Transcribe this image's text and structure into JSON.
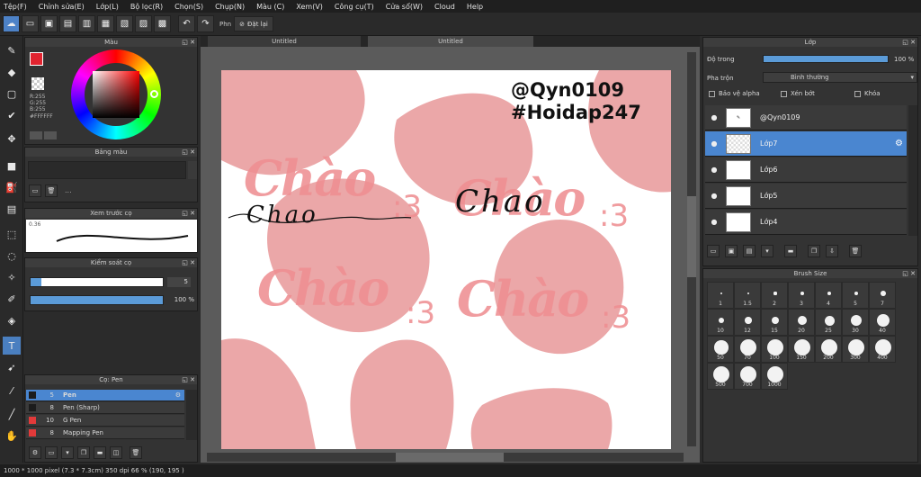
{
  "menu": [
    "Tệp(F)",
    "Chỉnh sửa(E)",
    "Lớp(L)",
    "Bộ lọc(R)",
    "Chọn(S)",
    "Chụp(N)",
    "Màu (C)",
    "Xem(V)",
    "Công cụ(T)",
    "Cửa sổ(W)",
    "Cloud",
    "Help"
  ],
  "toolbar": {
    "tool_label": "Phn",
    "reset_label": "Đặt lại"
  },
  "tabs": [
    "Untitled",
    "Untitled"
  ],
  "color_panel": {
    "title": "Màu",
    "rgb": "R:255\nG:255\nB:255",
    "hex": "#FFFFFF"
  },
  "swatch_panel": {
    "title": "Bảng màu",
    "dots": "..."
  },
  "preview_panel": {
    "title": "Xem trước cọ",
    "size": "0.36"
  },
  "brush_control": {
    "title": "Kiểm soát cọ",
    "size_value": "5",
    "opacity_value": "100 %"
  },
  "brush_panel": {
    "title": "Cọ: Pen",
    "items": [
      {
        "num": "5",
        "name": "Pen",
        "color": "#1c1c1c"
      },
      {
        "num": "8",
        "name": "Pen (Sharp)",
        "color": "#1c1c1c"
      },
      {
        "num": "10",
        "name": "G Pen",
        "color": "#e23a3a"
      },
      {
        "num": "8",
        "name": "Mapping Pen",
        "color": "#e23a3a"
      }
    ]
  },
  "layer_panel": {
    "title": "Lớp",
    "opacity_label": "Độ trong",
    "opacity_value": "100 %",
    "blend_label": "Pha trộn",
    "blend_value": "Bình thường",
    "protect_alpha": "Bảo vệ alpha",
    "clip": "Xén bớt",
    "lock": "Khóa",
    "layers": [
      {
        "name": "@Qyn0109"
      },
      {
        "name": "Lớp7"
      },
      {
        "name": "Lớp6"
      },
      {
        "name": "Lớp5"
      },
      {
        "name": "Lớp4"
      }
    ]
  },
  "brush_size_panel": {
    "title": "Brush Size",
    "sizes": [
      "1",
      "1.5",
      "2",
      "3",
      "4",
      "5",
      "7",
      "10",
      "12",
      "15",
      "20",
      "25",
      "30",
      "40",
      "50",
      "70",
      "100",
      "150",
      "200",
      "300",
      "400",
      "500",
      "700",
      "1000"
    ]
  },
  "artwork": {
    "handle_line1": "@Qyn0109",
    "handle_line2": "#Hoidap247",
    "text_chao": "Chào",
    "text_three": ":3",
    "text_chao2": "Chào",
    "text_three2": ":3",
    "text_chao3": "Chào",
    "text_three3": ":3",
    "text_chao4": "Chào",
    "text_three4": ":3",
    "script_1": "Chao",
    "script_2": "Chao",
    "pink_color": "#eba7a8",
    "text_color": "#ef8f92"
  },
  "status": "1000 * 1000 pixel   (7.3 * 7.3cm)   350 dpi   66 %   (190, 195 )"
}
